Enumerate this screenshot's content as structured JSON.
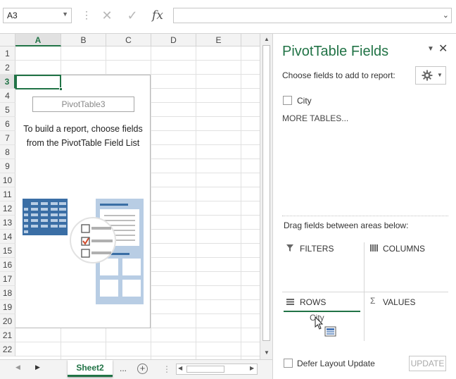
{
  "formula_bar": {
    "name_box": "A3",
    "cancel_icon": "✕",
    "enter_icon": "✓",
    "function_icon": "fx",
    "formula_value": ""
  },
  "sheet": {
    "columns": [
      "A",
      "B",
      "C",
      "D",
      "E"
    ],
    "rows": [
      "1",
      "2",
      "3",
      "4",
      "5",
      "6",
      "7",
      "8",
      "9",
      "10",
      "11",
      "12",
      "13",
      "14",
      "15",
      "16",
      "17",
      "18",
      "19",
      "20",
      "21",
      "22"
    ],
    "selected_column": "A",
    "selected_row": "3"
  },
  "pivot_placeholder": {
    "name": "PivotTable3",
    "message": "To build a report, choose fields from the PivotTable Field List"
  },
  "tabs": {
    "sheet_name": "Sheet2",
    "more": "...",
    "add": "+"
  },
  "pane": {
    "title": "PivotTable Fields",
    "choose_label": "Choose fields to add to report:",
    "fields": [
      {
        "label": "City",
        "checked": false
      }
    ],
    "more_tables": "MORE TABLES...",
    "drag_label": "Drag fields between areas below:",
    "areas": {
      "filters": "FILTERS",
      "columns": "COLUMNS",
      "rows": "ROWS",
      "values": "VALUES"
    },
    "rows_item": "City",
    "defer_label": "Defer Layout Update",
    "update_button": "UPDATE"
  },
  "colors": {
    "accent": "#217346",
    "illustration_blue": "#3a6ea5",
    "illustration_light": "#b8cde4"
  }
}
